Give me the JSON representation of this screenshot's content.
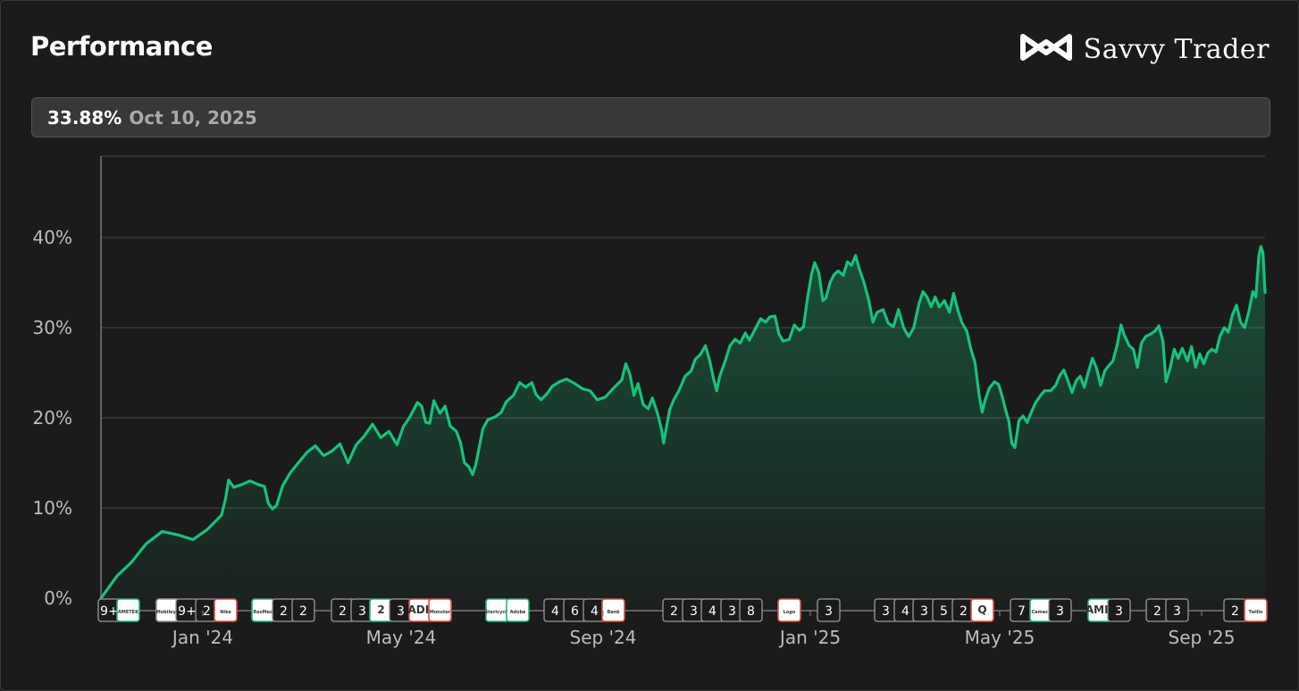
{
  "header": {
    "title": "Performance",
    "brand": "Savvy Trader"
  },
  "info": {
    "value": "33.88%",
    "date": "Oct 10, 2025"
  },
  "colors": {
    "line": "#17c27a",
    "grid": "#4a4a4a",
    "axis": "#8a8a8a",
    "tick": "#bdbdbd",
    "marker_green": "#1fb873",
    "marker_red": "#e24b3b",
    "marker_gray": "#9a9a9a"
  },
  "chart_data": {
    "type": "area",
    "x_range": [
      "2023-11",
      "2025-10"
    ],
    "y_range": [
      0,
      49
    ],
    "y_ticks": [
      "0%",
      "10%",
      "20%",
      "30%",
      "40%"
    ],
    "y_tick_values": [
      0,
      10,
      20,
      30,
      40
    ],
    "x_ticks": [
      "Jan '24",
      "May '24",
      "Sep '24",
      "Jan '25",
      "May '25",
      "Sep '25"
    ],
    "x_tick_dates": [
      "2024-01",
      "2024-05",
      "2024-09",
      "2025-01",
      "2025-05",
      "2025-09"
    ],
    "grid": true,
    "series": [
      {
        "values": [
          [
            0.0,
            0
          ],
          [
            0.8,
            2.5
          ],
          [
            1.5,
            4
          ],
          [
            2.2,
            6
          ],
          [
            3.0,
            7.4
          ],
          [
            3.8,
            7.0
          ],
          [
            4.5,
            6.5
          ],
          [
            5.2,
            7.6
          ],
          [
            5.9,
            9.2
          ],
          [
            6.1,
            11
          ],
          [
            6.25,
            13.1
          ],
          [
            6.5,
            12.3
          ],
          [
            6.9,
            12.6
          ],
          [
            7.3,
            13.0
          ],
          [
            7.7,
            12.6
          ],
          [
            8.0,
            12.4
          ],
          [
            8.2,
            10.5
          ],
          [
            8.4,
            9.9
          ],
          [
            8.6,
            10.3
          ],
          [
            8.9,
            12.5
          ],
          [
            9.3,
            14.0
          ],
          [
            9.7,
            15.1
          ],
          [
            10.1,
            16.2
          ],
          [
            10.5,
            16.9
          ],
          [
            10.9,
            15.8
          ],
          [
            11.3,
            16.3
          ],
          [
            11.7,
            17.1
          ],
          [
            12.1,
            15.0
          ],
          [
            12.5,
            17.0
          ],
          [
            12.9,
            18.0
          ],
          [
            13.3,
            19.3
          ],
          [
            13.7,
            17.8
          ],
          [
            14.1,
            18.5
          ],
          [
            14.5,
            17.0
          ],
          [
            14.8,
            19.0
          ],
          [
            15.1,
            20.0
          ],
          [
            15.5,
            21.7
          ],
          [
            15.7,
            21.3
          ],
          [
            15.9,
            19.5
          ],
          [
            16.1,
            19.4
          ],
          [
            16.3,
            21.9
          ],
          [
            16.6,
            20.5
          ],
          [
            16.85,
            21.3
          ],
          [
            17.1,
            19.1
          ],
          [
            17.4,
            18.5
          ],
          [
            17.6,
            17.3
          ],
          [
            17.8,
            15.0
          ],
          [
            18.0,
            14.6
          ],
          [
            18.2,
            13.7
          ],
          [
            18.35,
            14.8
          ],
          [
            18.5,
            16.5
          ],
          [
            18.7,
            18.8
          ],
          [
            18.95,
            19.8
          ],
          [
            19.3,
            20.1
          ],
          [
            19.6,
            20.6
          ],
          [
            19.85,
            21.8
          ],
          [
            20.2,
            22.5
          ],
          [
            20.5,
            23.9
          ],
          [
            20.8,
            23.4
          ],
          [
            21.1,
            23.9
          ],
          [
            21.3,
            22.6
          ],
          [
            21.55,
            22.0
          ],
          [
            21.85,
            22.7
          ],
          [
            22.1,
            23.5
          ],
          [
            22.45,
            24.0
          ],
          [
            22.8,
            24.3
          ],
          [
            23.2,
            23.8
          ],
          [
            23.6,
            23.2
          ],
          [
            23.95,
            23.0
          ],
          [
            24.3,
            22.0
          ],
          [
            24.7,
            22.3
          ],
          [
            25.1,
            23.3
          ],
          [
            25.5,
            24.2
          ],
          [
            25.7,
            26.0
          ],
          [
            25.9,
            24.8
          ],
          [
            26.1,
            22.5
          ],
          [
            26.3,
            23.8
          ],
          [
            26.55,
            21.5
          ],
          [
            26.8,
            21.0
          ],
          [
            27.0,
            22.2
          ],
          [
            27.25,
            20.5
          ],
          [
            27.45,
            18.7
          ],
          [
            27.55,
            17.2
          ],
          [
            27.7,
            19.1
          ],
          [
            27.85,
            20.9
          ],
          [
            28.05,
            22.0
          ],
          [
            28.3,
            23.0
          ],
          [
            28.6,
            24.6
          ],
          [
            28.9,
            25.2
          ],
          [
            29.1,
            26.5
          ],
          [
            29.35,
            27.0
          ],
          [
            29.6,
            28.0
          ],
          [
            29.8,
            26.4
          ],
          [
            30.0,
            24.3
          ],
          [
            30.15,
            23.0
          ],
          [
            30.3,
            24.6
          ],
          [
            30.55,
            26.2
          ],
          [
            30.8,
            28.0
          ],
          [
            31.05,
            28.7
          ],
          [
            31.3,
            28.3
          ],
          [
            31.55,
            29.4
          ],
          [
            31.75,
            28.6
          ],
          [
            32.0,
            29.7
          ],
          [
            32.3,
            31.0
          ],
          [
            32.55,
            30.6
          ],
          [
            32.75,
            31.2
          ],
          [
            33.0,
            31.3
          ],
          [
            33.2,
            29.3
          ],
          [
            33.4,
            28.5
          ],
          [
            33.7,
            28.7
          ],
          [
            33.95,
            30.3
          ],
          [
            34.2,
            29.7
          ],
          [
            34.4,
            30.1
          ],
          [
            34.6,
            33.3
          ],
          [
            34.8,
            36.0
          ],
          [
            34.95,
            37.2
          ],
          [
            35.15,
            36.1
          ],
          [
            35.35,
            33.0
          ],
          [
            35.5,
            33.3
          ],
          [
            35.7,
            35.0
          ],
          [
            35.9,
            35.9
          ],
          [
            36.1,
            36.3
          ],
          [
            36.35,
            35.8
          ],
          [
            36.55,
            37.3
          ],
          [
            36.75,
            36.9
          ],
          [
            36.95,
            38.0
          ],
          [
            37.15,
            36.4
          ],
          [
            37.35,
            35.1
          ],
          [
            37.6,
            33.0
          ],
          [
            37.8,
            30.6
          ],
          [
            38.0,
            31.7
          ],
          [
            38.3,
            32.0
          ],
          [
            38.55,
            30.5
          ],
          [
            38.8,
            30.1
          ],
          [
            39.05,
            32.0
          ],
          [
            39.3,
            30.0
          ],
          [
            39.55,
            29.0
          ],
          [
            39.8,
            30.0
          ],
          [
            40.05,
            32.6
          ],
          [
            40.25,
            34.0
          ],
          [
            40.45,
            33.4
          ],
          [
            40.65,
            32.3
          ],
          [
            40.85,
            33.4
          ],
          [
            41.05,
            32.3
          ],
          [
            41.3,
            33.0
          ],
          [
            41.55,
            31.7
          ],
          [
            41.75,
            33.8
          ],
          [
            41.95,
            32.0
          ],
          [
            42.15,
            30.6
          ],
          [
            42.4,
            29.6
          ],
          [
            42.6,
            27.6
          ],
          [
            42.8,
            26.1
          ],
          [
            43.0,
            22.5
          ],
          [
            43.15,
            20.6
          ],
          [
            43.3,
            22.0
          ],
          [
            43.5,
            23.3
          ],
          [
            43.75,
            24.0
          ],
          [
            43.95,
            23.7
          ],
          [
            44.15,
            22.2
          ],
          [
            44.3,
            20.8
          ],
          [
            44.45,
            19.7
          ],
          [
            44.6,
            17.2
          ],
          [
            44.75,
            16.7
          ],
          [
            44.95,
            19.7
          ],
          [
            45.15,
            20.2
          ],
          [
            45.35,
            19.5
          ],
          [
            45.55,
            20.6
          ],
          [
            45.75,
            21.6
          ],
          [
            45.95,
            22.3
          ],
          [
            46.2,
            23.0
          ],
          [
            46.5,
            23.0
          ],
          [
            46.75,
            23.6
          ],
          [
            46.95,
            24.7
          ],
          [
            47.15,
            25.3
          ],
          [
            47.35,
            24.1
          ],
          [
            47.55,
            22.8
          ],
          [
            47.75,
            24.1
          ],
          [
            47.95,
            24.6
          ],
          [
            48.15,
            23.4
          ],
          [
            48.35,
            25.1
          ],
          [
            48.55,
            26.6
          ],
          [
            48.75,
            25.5
          ],
          [
            48.95,
            23.6
          ],
          [
            49.15,
            25.2
          ],
          [
            49.35,
            25.8
          ],
          [
            49.55,
            26.3
          ],
          [
            49.75,
            28.0
          ],
          [
            49.95,
            30.3
          ],
          [
            50.1,
            29.2
          ],
          [
            50.35,
            28.0
          ],
          [
            50.55,
            27.6
          ],
          [
            50.75,
            25.6
          ],
          [
            50.95,
            28.3
          ],
          [
            51.15,
            29.0
          ],
          [
            51.4,
            29.3
          ],
          [
            51.6,
            29.6
          ],
          [
            51.8,
            30.2
          ],
          [
            52.0,
            28.5
          ],
          [
            52.15,
            24.0
          ],
          [
            52.35,
            25.5
          ],
          [
            52.55,
            27.6
          ],
          [
            52.75,
            26.6
          ],
          [
            52.95,
            27.7
          ],
          [
            53.2,
            26.3
          ],
          [
            53.4,
            27.9
          ],
          [
            53.6,
            25.6
          ],
          [
            53.8,
            27.1
          ],
          [
            54.0,
            26.0
          ],
          [
            54.2,
            27.2
          ],
          [
            54.4,
            27.6
          ],
          [
            54.6,
            27.3
          ],
          [
            54.8,
            29.1
          ],
          [
            55.0,
            30.0
          ],
          [
            55.2,
            29.5
          ],
          [
            55.4,
            31.4
          ],
          [
            55.6,
            32.5
          ],
          [
            55.8,
            30.6
          ],
          [
            56.0,
            30.0
          ],
          [
            56.2,
            31.7
          ],
          [
            56.4,
            34.0
          ],
          [
            56.55,
            33.4
          ],
          [
            56.7,
            38.0
          ],
          [
            56.8,
            39.0
          ],
          [
            56.9,
            38.3
          ],
          [
            57.0,
            33.9
          ]
        ]
      }
    ],
    "markers": [
      {
        "type": "count",
        "text": "9+",
        "color": "gray"
      },
      {
        "type": "logo",
        "text": "AMETEK",
        "color": "green"
      },
      {
        "type": "logo",
        "text": "Mobileye",
        "color": "gray"
      },
      {
        "type": "count",
        "text": "9+",
        "color": "gray"
      },
      {
        "type": "count",
        "text": "2",
        "color": "gray"
      },
      {
        "type": "logo",
        "text": "Nike",
        "color": "red"
      },
      {
        "type": "logo",
        "text": "ResMed",
        "color": "green"
      },
      {
        "type": "count",
        "text": "2",
        "color": "gray"
      },
      {
        "type": "count",
        "text": "2",
        "color": "gray"
      },
      {
        "type": "count",
        "text": "2",
        "color": "gray"
      },
      {
        "type": "count",
        "text": "3",
        "color": "gray"
      },
      {
        "type": "logo",
        "text": "2",
        "color": "green"
      },
      {
        "type": "count",
        "text": "3",
        "color": "gray"
      },
      {
        "type": "logo",
        "text": "ADP",
        "color": "red"
      },
      {
        "type": "logo",
        "text": "Monster",
        "color": "red"
      },
      {
        "type": "logo",
        "text": "Stericycle",
        "color": "green"
      },
      {
        "type": "logo",
        "text": "Adobe",
        "color": "green"
      },
      {
        "type": "count",
        "text": "4",
        "color": "gray"
      },
      {
        "type": "count",
        "text": "6",
        "color": "gray"
      },
      {
        "type": "count",
        "text": "4",
        "color": "gray"
      },
      {
        "type": "logo",
        "text": "Bank",
        "color": "red"
      },
      {
        "type": "count",
        "text": "2",
        "color": "gray"
      },
      {
        "type": "count",
        "text": "3",
        "color": "gray"
      },
      {
        "type": "count",
        "text": "4",
        "color": "gray"
      },
      {
        "type": "count",
        "text": "3",
        "color": "gray"
      },
      {
        "type": "count",
        "text": "8",
        "color": "gray"
      },
      {
        "type": "logo",
        "text": "Logo",
        "color": "red"
      },
      {
        "type": "count",
        "text": "3",
        "color": "gray"
      },
      {
        "type": "count",
        "text": "3",
        "color": "gray"
      },
      {
        "type": "count",
        "text": "4",
        "color": "gray"
      },
      {
        "type": "count",
        "text": "3",
        "color": "gray"
      },
      {
        "type": "count",
        "text": "5",
        "color": "gray"
      },
      {
        "type": "count",
        "text": "2",
        "color": "gray"
      },
      {
        "type": "logo",
        "text": "Q",
        "color": "red"
      },
      {
        "type": "count",
        "text": "7",
        "color": "gray"
      },
      {
        "type": "logo",
        "text": "Cameco",
        "color": "green"
      },
      {
        "type": "count",
        "text": "3",
        "color": "gray"
      },
      {
        "type": "logo",
        "text": "AMD",
        "color": "green"
      },
      {
        "type": "count",
        "text": "3",
        "color": "gray"
      },
      {
        "type": "count",
        "text": "2",
        "color": "gray"
      },
      {
        "type": "count",
        "text": "3",
        "color": "gray"
      },
      {
        "type": "count",
        "text": "2",
        "color": "gray"
      },
      {
        "type": "logo",
        "text": "Twilio",
        "color": "red"
      }
    ]
  }
}
